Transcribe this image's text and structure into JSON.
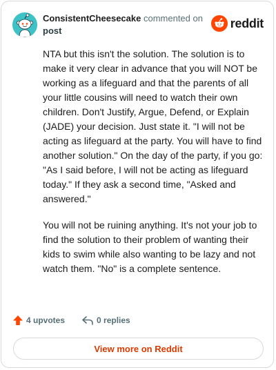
{
  "header": {
    "username": "ConsistentCheesecake",
    "action_text": "commented on",
    "post_link": "post",
    "brand_name": "reddit",
    "avatar_icon": "snoo-avatar-icon",
    "brand_icon": "reddit-logo-icon"
  },
  "comment": {
    "paragraphs": [
      "NTA but this isn't the solution. The solution is to make it very clear in advance that you will NOT be working as a lifeguard and that the parents of all your little cousins will need to watch their own children. Don't Justify, Argue, Defend, or Explain (JADE) your decision. Just state it. \"I will not be acting as lifeguard at the party. You will have to find another solution.\" On the day of the party, if you go: \"As I said before, I will not be acting as lifeguard today.\" If they ask a second time, \"Asked and answered.\"",
      "You will not be ruining anything. It's not your job to find the solution to their problem of wanting their kids to swim while also wanting to be lazy and not watch them. \"No\" is a complete sentence."
    ]
  },
  "actions": {
    "upvotes": "4 upvotes",
    "replies": "0 replies",
    "upvote_icon": "upvote-arrow-icon",
    "reply_icon": "reply-icon"
  },
  "footer": {
    "view_more": "View more on Reddit"
  },
  "colors": {
    "accent": "#ff4500",
    "link": "#d93a00",
    "avatar_bg": "#3ec2c6",
    "muted": "#576f76"
  }
}
